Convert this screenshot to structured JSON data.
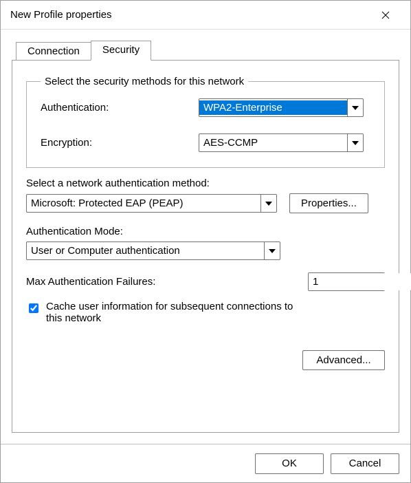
{
  "window": {
    "title": "New Profile properties"
  },
  "tabs": {
    "connection": "Connection",
    "security": "Security",
    "active": "security"
  },
  "groupbox": {
    "legend": "Select the security methods for this network",
    "auth_label": "Authentication:",
    "auth_value": "WPA2-Enterprise",
    "enc_label": "Encryption:",
    "enc_value": "AES-CCMP"
  },
  "method": {
    "label": "Select a network authentication method:",
    "value": "Microsoft: Protected EAP (PEAP)",
    "properties_btn": "Properties..."
  },
  "mode": {
    "label": "Authentication Mode:",
    "value": "User or Computer authentication"
  },
  "max": {
    "label": "Max Authentication Failures:",
    "value": "1"
  },
  "cache": {
    "checked": true,
    "label": "Cache user information for subsequent connections to this network"
  },
  "advanced_btn": "Advanced...",
  "buttons": {
    "ok": "OK",
    "cancel": "Cancel"
  }
}
